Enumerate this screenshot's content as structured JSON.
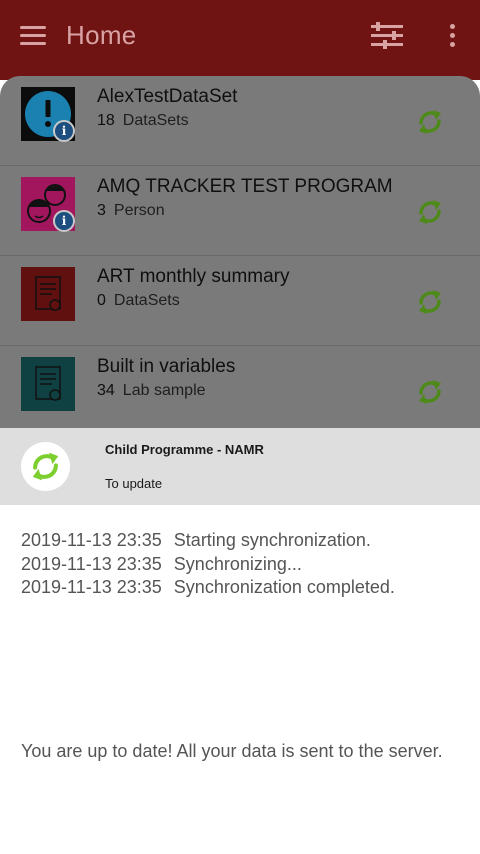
{
  "appbar": {
    "title": "Home",
    "menu_icon": "hamburger-menu-icon",
    "filter_icon": "filter-sliders-icon",
    "more_icon": "more-vertical-icon",
    "color": "#6f1313"
  },
  "programs": [
    {
      "name": "AlexTestDataSet",
      "count": "18",
      "unit": "DataSets",
      "icon": "exclamation-circle-icon",
      "icon_bg": "#1b81b1",
      "has_info": true
    },
    {
      "name": "AMQ TRACKER TEST PROGRAM",
      "count": "3",
      "unit": "Person",
      "icon": "children-faces-icon",
      "icon_bg": "#a2165e",
      "has_info": true
    },
    {
      "name": "ART monthly summary",
      "count": "0",
      "unit": "DataSets",
      "icon": "document-icon",
      "icon_bg": "#611010",
      "has_info": false
    },
    {
      "name": "Built in variables",
      "count": "34",
      "unit": "Lab sample",
      "icon": "document-icon",
      "icon_bg": "#0f4142",
      "has_info": false
    }
  ],
  "sync_icon_color": "#4e8a1a",
  "sync": {
    "program": "Child Programme - NAMR",
    "state": "To update",
    "logo_icon": "sync-arrows-icon",
    "logo_color": "#7ccf2e",
    "log": [
      {
        "time": "2019-11-13 23:35",
        "message": "Starting synchronization."
      },
      {
        "time": "2019-11-13 23:35",
        "message": "Synchronizing..."
      },
      {
        "time": "2019-11-13 23:35",
        "message": "Synchronization completed."
      }
    ],
    "status_message": "You are up to date! All your data is sent to the server."
  }
}
